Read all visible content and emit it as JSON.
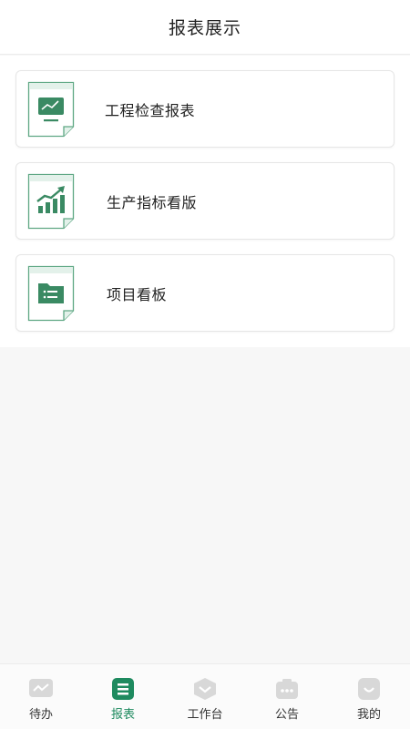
{
  "header": {
    "title": "报表展示"
  },
  "cards": [
    {
      "label": "工程检查报表",
      "icon": "monitor-chart-icon"
    },
    {
      "label": "生产指标看版",
      "icon": "growth-bars-icon"
    },
    {
      "label": "项目看板",
      "icon": "folder-list-icon"
    }
  ],
  "tabbar": {
    "items": [
      {
        "label": "待办",
        "icon": "todo-icon",
        "active": false
      },
      {
        "label": "报表",
        "icon": "report-icon",
        "active": true
      },
      {
        "label": "工作台",
        "icon": "workbench-icon",
        "active": false
      },
      {
        "label": "公告",
        "icon": "announcement-icon",
        "active": false
      },
      {
        "label": "我的",
        "icon": "profile-icon",
        "active": false
      }
    ]
  },
  "colors": {
    "accent": "#1e8a5f",
    "icon_green": "#3a8a63",
    "doc_border": "#5fa884",
    "doc_fill": "#e3f1ea",
    "inactive_icon": "#d8d8d8"
  }
}
